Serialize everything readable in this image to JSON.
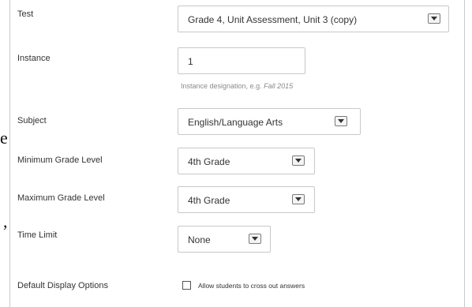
{
  "background_text": {
    "fragment_1": "e",
    "fragment_2": ","
  },
  "form": {
    "test": {
      "label": "Test",
      "value": "Grade 4, Unit Assessment, Unit 3 (copy)"
    },
    "instance": {
      "label": "Instance",
      "value": "1",
      "hint_prefix": "Instance designation, e.g.",
      "hint_example": "Fall 2015"
    },
    "subject": {
      "label": "Subject",
      "value": "English/Language Arts"
    },
    "min_grade": {
      "label": "Minimum Grade Level",
      "value": "4th Grade"
    },
    "max_grade": {
      "label": "Maximum Grade Level",
      "value": "4th Grade"
    },
    "time_limit": {
      "label": "Time Limit",
      "value": "None"
    },
    "display_options": {
      "label": "Default Display Options",
      "checkbox_label": "Allow students to cross out answers",
      "checked": false
    }
  },
  "icons": {
    "dropdown": "chevron-down-icon"
  },
  "colors": {
    "border": "#c8c8c8",
    "label_text": "#333333",
    "hint_text": "#8a8a8a"
  }
}
